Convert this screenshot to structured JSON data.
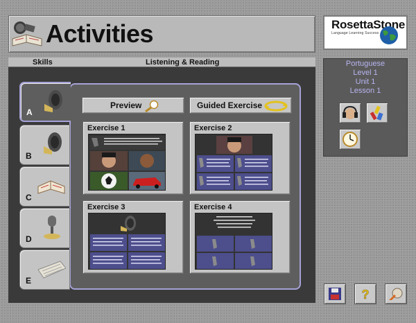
{
  "header": {
    "title": "Activities"
  },
  "logo": {
    "name": "RosettaStone",
    "tagline": "Language Learning Success"
  },
  "nav": {
    "skills_label": "Skills",
    "mode_label": "Listening & Reading"
  },
  "tabs": [
    {
      "letter": "A",
      "icon": "speaker-icon",
      "active": true
    },
    {
      "letter": "B",
      "icon": "speaker-icon",
      "active": false
    },
    {
      "letter": "C",
      "icon": "book-icon",
      "active": false
    },
    {
      "letter": "D",
      "icon": "microphone-icon",
      "active": false
    },
    {
      "letter": "E",
      "icon": "keyboard-icon",
      "active": false
    }
  ],
  "buttons": {
    "preview": "Preview",
    "guided": "Guided Exercise"
  },
  "exercises": [
    {
      "title": "Exercise 1"
    },
    {
      "title": "Exercise 2"
    },
    {
      "title": "Exercise 3"
    },
    {
      "title": "Exercise 4"
    }
  ],
  "course": {
    "language": "Portuguese",
    "level": "Level 1",
    "unit": "Unit 1",
    "lesson": "Lesson 1"
  },
  "tools": [
    "headphones-icon",
    "tools-icon",
    "clock-icon"
  ],
  "footer_buttons": [
    "save-icon",
    "help-icon",
    "exit-icon"
  ],
  "colors": {
    "panel_border": "#a5a2d8",
    "info_text": "#b7b4f0",
    "lavender": "#4d4e8c"
  }
}
